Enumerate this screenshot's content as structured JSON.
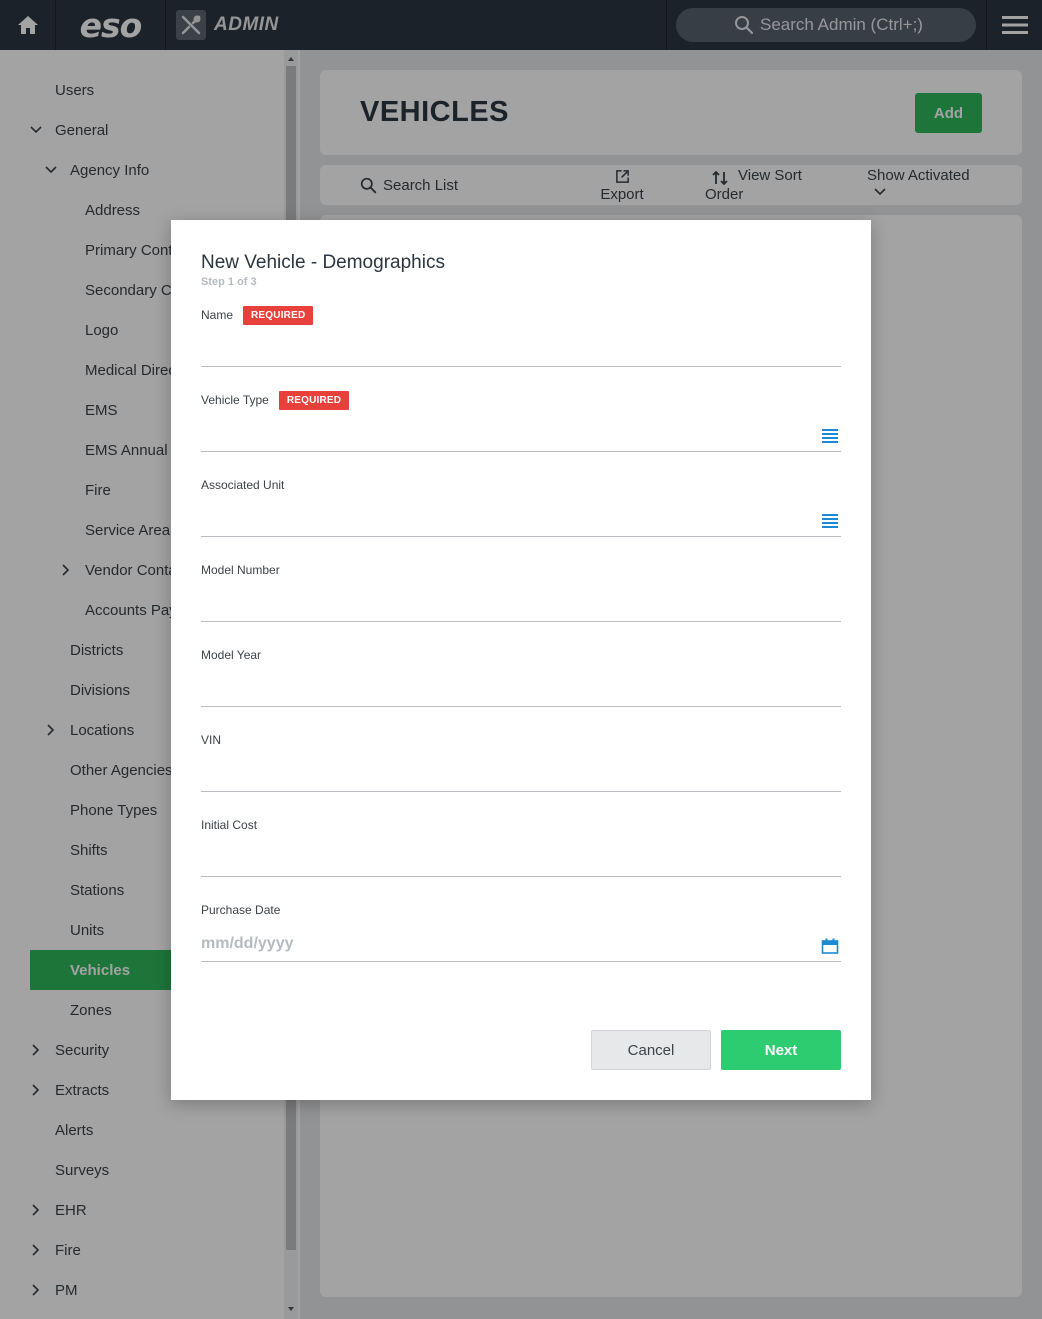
{
  "topbar": {
    "logo": "eso",
    "app_label": "ADMIN",
    "search_placeholder": "Search Admin (Ctrl+;)"
  },
  "sidebar": {
    "items": [
      {
        "label": "Users"
      },
      {
        "label": "General",
        "expanded": true
      },
      {
        "label": "Agency Info",
        "expanded": true
      },
      {
        "label": "Address"
      },
      {
        "label": "Primary Cont"
      },
      {
        "label": "Secondary Co"
      },
      {
        "label": "Logo"
      },
      {
        "label": "Medical Direc"
      },
      {
        "label": "EMS"
      },
      {
        "label": "EMS Annual S"
      },
      {
        "label": "Fire"
      },
      {
        "label": "Service Area"
      },
      {
        "label": "Vendor Conta",
        "expanded": false
      },
      {
        "label": "Accounts Pay"
      },
      {
        "label": "Districts"
      },
      {
        "label": "Divisions"
      },
      {
        "label": "Locations",
        "expanded": false
      },
      {
        "label": "Other Agencies"
      },
      {
        "label": "Phone Types"
      },
      {
        "label": "Shifts"
      },
      {
        "label": "Stations"
      },
      {
        "label": "Units"
      },
      {
        "label": "Vehicles",
        "active": true
      },
      {
        "label": "Zones"
      },
      {
        "label": "Security",
        "expanded": false
      },
      {
        "label": "Extracts",
        "expanded": false
      },
      {
        "label": "Alerts"
      },
      {
        "label": "Surveys"
      },
      {
        "label": "EHR",
        "expanded": false
      },
      {
        "label": "Fire",
        "expanded": false
      },
      {
        "label": "PM",
        "expanded": false
      }
    ]
  },
  "main": {
    "title": "VEHICLES",
    "add_label": "Add",
    "toolbar": {
      "search": "Search List",
      "export": "Export",
      "sort_line1": "View Sort",
      "sort_line2": "Order",
      "show": "Show Activated"
    }
  },
  "modal": {
    "title": "New Vehicle - Demographics",
    "step": "Step 1 of 3",
    "required_badge": "REQUIRED",
    "fields": [
      {
        "label": "Name",
        "required": true,
        "value": ""
      },
      {
        "label": "Vehicle Type",
        "required": true,
        "value": "",
        "icon": "list-icon"
      },
      {
        "label": "Associated Unit",
        "required": false,
        "value": "",
        "icon": "list-icon"
      },
      {
        "label": "Model Number",
        "required": false,
        "value": ""
      },
      {
        "label": "Model Year",
        "required": false,
        "value": ""
      },
      {
        "label": "VIN",
        "required": false,
        "value": ""
      },
      {
        "label": "Initial Cost",
        "required": false,
        "value": ""
      },
      {
        "label": "Purchase Date",
        "required": false,
        "value": "",
        "placeholder": "mm/dd/yyyy",
        "icon": "calendar-icon"
      }
    ],
    "cancel_label": "Cancel",
    "next_label": "Next"
  },
  "colors": {
    "topbar": "#2b3640",
    "accent_green": "#2eb85c",
    "next_green": "#2ecc71",
    "required_red": "#e8413b",
    "icon_blue": "#1a8bd3"
  }
}
